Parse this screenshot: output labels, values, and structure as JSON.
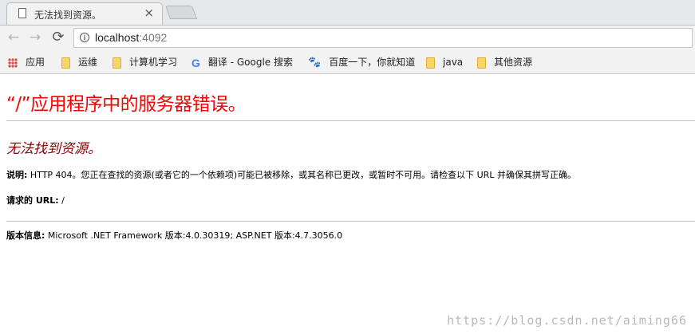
{
  "browser": {
    "tab": {
      "title": "无法找到资源。",
      "close": "×"
    },
    "nav": {
      "back": "←",
      "forward": "→",
      "reload": "⟳"
    },
    "omnibox": {
      "host": "localhost",
      "port": ":4092"
    },
    "bookmarks": [
      {
        "label": "应用",
        "icon": "apps-icon"
      },
      {
        "label": "运维",
        "icon": "folder-icon"
      },
      {
        "label": "计算机学习",
        "icon": "folder-icon"
      },
      {
        "label": "翻译 - Google 搜索",
        "icon": "google-icon"
      },
      {
        "label": "百度一下，你就知道",
        "icon": "baidu-paw-icon"
      },
      {
        "label": "java",
        "icon": "folder-icon"
      },
      {
        "label": "其他资源",
        "icon": "folder-icon"
      }
    ]
  },
  "page": {
    "server_error": "“/”应用程序中的服务器错误。",
    "resource_error": "无法找到资源。",
    "description_label": "说明:",
    "description_text": " HTTP 404。您正在查找的资源(或者它的一个依赖项)可能已被移除，或其名称已更改，或暂时不可用。请检查以下 URL 并确保其拼写正确。",
    "requested_url_label": "请求的 URL:",
    "requested_url_value": " /",
    "version_label": "版本信息:",
    "version_text": " Microsoft .NET Framework 版本:4.0.30319; ASP.NET 版本:4.7.3056.0"
  },
  "watermark": "https://blog.csdn.net/aiming66"
}
